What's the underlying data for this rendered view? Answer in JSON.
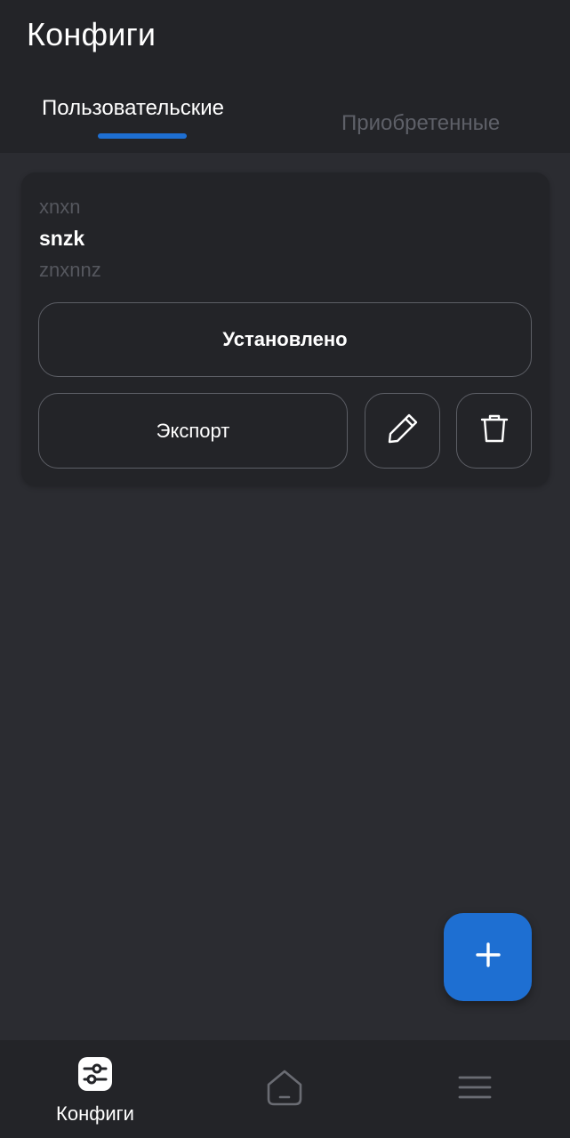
{
  "header": {
    "title": "Конфиги",
    "tabs": [
      {
        "label": "Пользовательские",
        "active": true
      },
      {
        "label": "Приобретенные",
        "active": false
      }
    ]
  },
  "config_card": {
    "line1": "xnxn",
    "name": "snzk",
    "line3": "znxnnz",
    "installed_label": "Установлено",
    "export_label": "Экспорт",
    "edit_icon": "pencil-icon",
    "delete_icon": "trash-icon"
  },
  "fab": {
    "icon": "plus-icon"
  },
  "bottom_nav": {
    "items": [
      {
        "label": "Конфиги",
        "icon": "sliders-icon",
        "active": true
      },
      {
        "label": "",
        "icon": "home-icon",
        "active": false
      },
      {
        "label": "",
        "icon": "menu-icon",
        "active": false
      }
    ]
  },
  "colors": {
    "background": "#2b2c31",
    "surface": "#232428",
    "accent": "#1e6fd2",
    "muted_text": "#55575e",
    "border": "#5d5f66"
  }
}
